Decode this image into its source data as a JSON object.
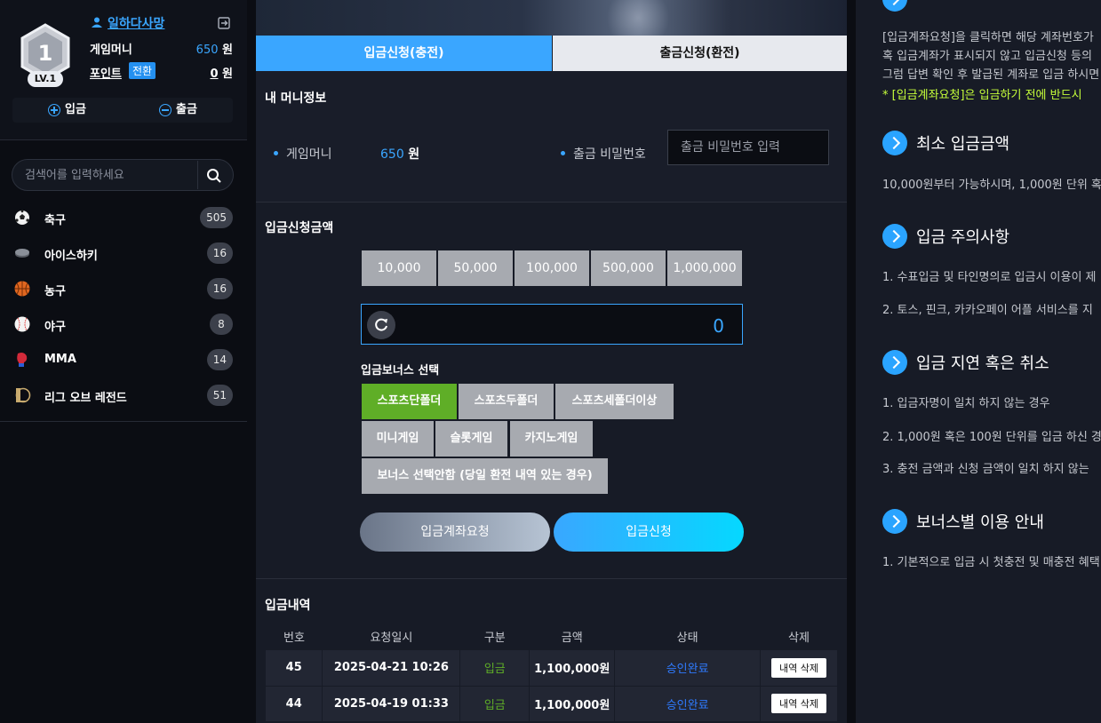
{
  "user": {
    "level_number": "1",
    "level_label": "LV.1",
    "name": "일하다사망",
    "game_money_label": "게임머니",
    "game_money_value": "650",
    "game_money_unit": "원",
    "point_label": "포인트",
    "point_switch": "전환",
    "point_value": "0",
    "point_unit": "원",
    "deposit_label": "입금",
    "withdraw_label": "출금"
  },
  "search": {
    "placeholder": "검색어를 입력하세요"
  },
  "sports": [
    {
      "name": "축구",
      "count": "505",
      "icon": "soccer-ball-icon"
    },
    {
      "name": "아이스하키",
      "count": "16",
      "icon": "hockey-puck-icon"
    },
    {
      "name": "농구",
      "count": "16",
      "icon": "basketball-icon"
    },
    {
      "name": "야구",
      "count": "8",
      "icon": "baseball-icon"
    },
    {
      "name": "MMA",
      "count": "14",
      "icon": "boxing-glove-icon"
    },
    {
      "name": "리그 오브 레전드",
      "count": "51",
      "icon": "lol-icon"
    }
  ],
  "tabs": {
    "deposit": "입금신청(충전)",
    "withdraw": "출금신청(환전)"
  },
  "money_info": {
    "title": "내 머니정보",
    "game_money_label": "게임머니",
    "game_money_value": "650",
    "game_money_unit": "원",
    "pw_label": "출금 비밀번호",
    "pw_placeholder": "출금 비밀번호 입력"
  },
  "deposit_amount": {
    "title": "입금신청금액",
    "presets": [
      "10,000",
      "50,000",
      "100,000",
      "500,000",
      "1,000,000"
    ],
    "value": "0"
  },
  "bonus": {
    "title": "입금보너스 선택",
    "options": [
      "스포츠단폴더",
      "스포츠두폴더",
      "스포츠세폴더이상",
      "미니게임",
      "슬롯게임",
      "카지노게임",
      "보너스 선택안함 (당일 환전 내역 있는 경우)"
    ],
    "selected": "스포츠단폴더"
  },
  "actions": {
    "account_request": "입금계좌요청",
    "apply": "입금신청"
  },
  "history": {
    "title": "입금내역",
    "columns": [
      "번호",
      "요청일시",
      "구분",
      "금액",
      "상태",
      "삭제"
    ],
    "rows": [
      {
        "no": "45",
        "date": "2025-04-21 10:26",
        "type": "입금",
        "amount": "1,100,000원",
        "status": "승인완료",
        "delete": "내역 삭제"
      },
      {
        "no": "44",
        "date": "2025-04-19 01:33",
        "type": "입금",
        "amount": "1,100,000원",
        "status": "승인완료",
        "delete": "내역 삭제"
      }
    ]
  },
  "guide": {
    "top_text": [
      "[입금계좌요청]을 클릭하면 해당 계좌번호가",
      "혹 입금계좌가 표시되지 않고 입금신청 등의",
      "그럼 답변 확인 후 발급된 계좌로 입금 하시면"
    ],
    "top_note": "* [입금계좌요청]은 입금하기 전에 반드시",
    "sections": [
      {
        "title": "최소 입금금액",
        "lines": [
          "10,000원부터 가능하시며, 1,000원 단위 혹"
        ]
      },
      {
        "title": "입금 주의사항",
        "lines": [
          "1. 수표입금 및 타인명의로 입금시 이용이 제",
          "2. 토스, 핀크, 카카오페이 어플 서비스를 지"
        ]
      },
      {
        "title": "입금 지연 혹은 취소",
        "lines": [
          "1. 입금자명이 일치 하지 않는 경우",
          "2. 1,000원 혹은 100원 단위를 입금 하신 경",
          "3. 충전 금액과 신청 금액이 일치 하지 않는"
        ]
      },
      {
        "title": "보너스별 이용 안내",
        "lines": [
          "1. 기본적으로 입금 시 첫충전 및 매충전 혜택"
        ]
      }
    ]
  },
  "colors": {
    "accent": "#3aa6ff",
    "selected_bonus": "#5fae27",
    "status_done": "#2f7bff"
  }
}
